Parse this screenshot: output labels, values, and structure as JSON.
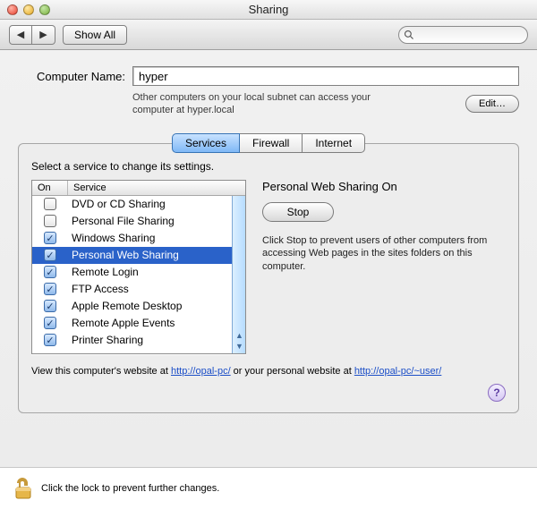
{
  "window": {
    "title": "Sharing"
  },
  "toolbar": {
    "show_all": "Show All",
    "search_placeholder": ""
  },
  "computer_name": {
    "label": "Computer Name:",
    "value": "hyper",
    "note": "Other computers on your local subnet can access your computer at hyper.local",
    "edit_btn": "Edit…"
  },
  "tabs": {
    "items": [
      "Services",
      "Firewall",
      "Internet"
    ],
    "active_index": 0
  },
  "services_panel": {
    "instruction": "Select a service to change its settings.",
    "columns": {
      "on": "On",
      "service": "Service"
    },
    "rows": [
      {
        "on": false,
        "name": "DVD or CD Sharing",
        "selected": false
      },
      {
        "on": false,
        "name": "Personal File Sharing",
        "selected": false
      },
      {
        "on": true,
        "name": "Windows Sharing",
        "selected": false
      },
      {
        "on": true,
        "name": "Personal Web Sharing",
        "selected": true
      },
      {
        "on": true,
        "name": "Remote Login",
        "selected": false
      },
      {
        "on": true,
        "name": "FTP Access",
        "selected": false
      },
      {
        "on": true,
        "name": "Apple Remote Desktop",
        "selected": false
      },
      {
        "on": true,
        "name": "Remote Apple Events",
        "selected": false
      },
      {
        "on": true,
        "name": "Printer Sharing",
        "selected": false
      }
    ],
    "detail": {
      "title": "Personal Web Sharing On",
      "stop_btn": "Stop",
      "desc": "Click Stop to prevent users of other computers from accessing Web pages in the sites folders on this computer."
    },
    "footer_pre": "View this computer's website at ",
    "footer_link1": "http://opal-pc/",
    "footer_mid": " or your personal website at ",
    "footer_link2": "http://opal-pc/~user/"
  },
  "help_btn": "?",
  "lockbar": {
    "text": "Click the lock to prevent further changes."
  }
}
